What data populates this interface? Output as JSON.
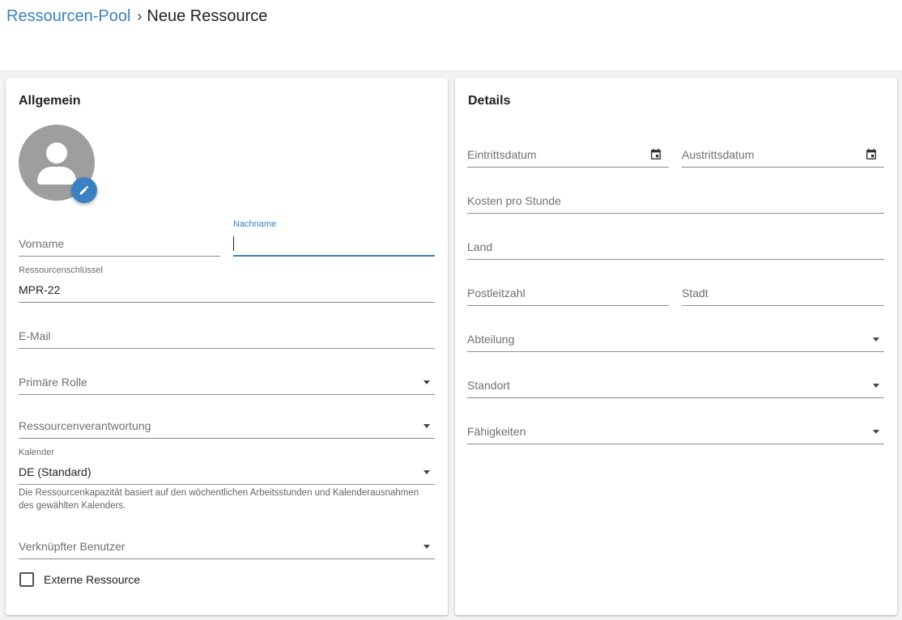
{
  "breadcrumb": {
    "parent": "Ressourcen-Pool",
    "separator": "›",
    "current": "Neue Ressource"
  },
  "general": {
    "title": "Allgemein",
    "first_name": {
      "placeholder": "Vorname",
      "value": ""
    },
    "last_name": {
      "label": "Nachname",
      "value": ""
    },
    "resource_key": {
      "label": "Ressourcenschlüssel",
      "value": "MPR-22"
    },
    "email": {
      "placeholder": "E-Mail"
    },
    "primary_role": {
      "placeholder": "Primäre Rolle"
    },
    "resource_owner": {
      "placeholder": "Ressourcenverantwortung"
    },
    "calendar": {
      "label": "Kalender",
      "value": "DE (Standard)",
      "hint": "Die Ressourcenkapazität basiert auf den wöchentlichen Arbeitsstunden und Kalenderausnahmen des gewählten Kalenders."
    },
    "linked_user": {
      "placeholder": "Verknüpfter Benutzer"
    },
    "external_resource": {
      "label": "Externe Ressource",
      "checked": false
    }
  },
  "details": {
    "title": "Details",
    "entry_date": {
      "placeholder": "Eintrittsdatum"
    },
    "exit_date": {
      "placeholder": "Austrittsdatum"
    },
    "cost_per_hour": {
      "placeholder": "Kosten pro Stunde"
    },
    "country": {
      "placeholder": "Land"
    },
    "postal_code": {
      "placeholder": "Postleitzahl"
    },
    "city": {
      "placeholder": "Stadt"
    },
    "department": {
      "placeholder": "Abteilung"
    },
    "location": {
      "placeholder": "Standort"
    },
    "skills": {
      "placeholder": "Fähigkeiten"
    }
  },
  "colors": {
    "accent": "#3b80c0",
    "avatar": "#9e9e9e"
  },
  "icons": {
    "avatar": "person-icon",
    "edit": "pencil-icon",
    "breadcrumb_separator": "chevron-right-icon",
    "date": "calendar-icon",
    "dropdown": "caret-down-icon"
  }
}
